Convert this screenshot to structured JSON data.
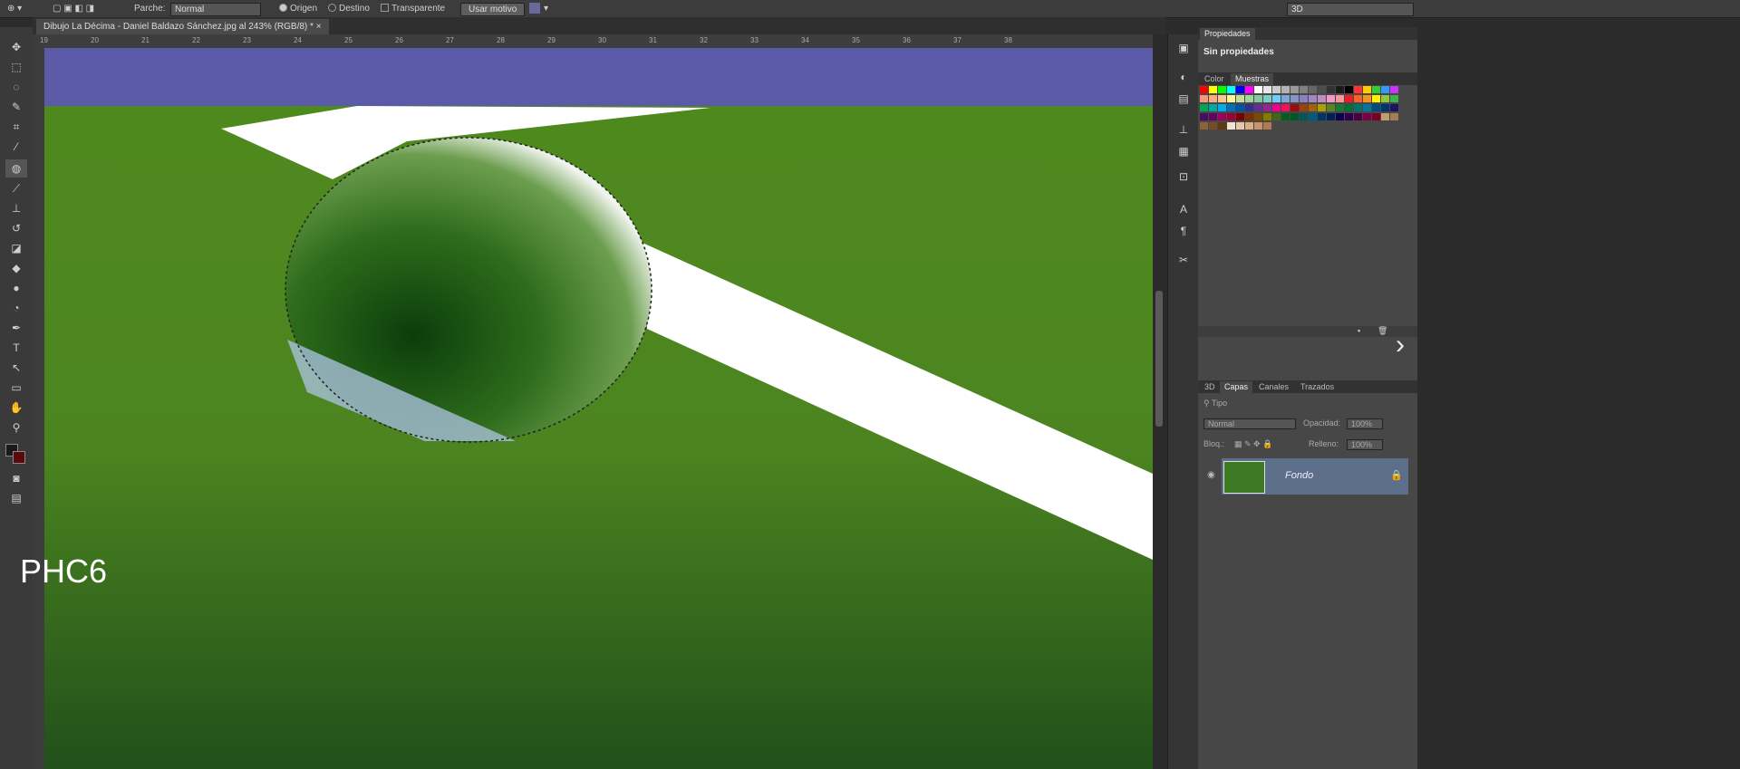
{
  "options_bar": {
    "patch_label": "Parche:",
    "patch_mode": "Normal",
    "radio_source": "Origen",
    "radio_dest": "Destino",
    "transparent_label": "Transparente",
    "use_pattern_button": "Usar motivo",
    "workspace": "3D"
  },
  "document": {
    "tab_title": "Dibujo La Décima - Daniel Baldazo Sánchez.jpg al 243% (RGB/8) *"
  },
  "ruler": {
    "top_ticks": [
      "19",
      "20",
      "21",
      "22",
      "23",
      "24",
      "25",
      "26",
      "27",
      "28",
      "29",
      "30",
      "31",
      "32",
      "33",
      "34",
      "35",
      "36",
      "37",
      "38"
    ]
  },
  "properties_panel": {
    "tab": "Propiedades",
    "content": "Sin propiedades"
  },
  "color_panel": {
    "tabs": [
      "Color",
      "Muestras"
    ],
    "swatch_rows": [
      [
        "#ff0000",
        "#ffff00",
        "#00ff00",
        "#00ffff",
        "#0000ff",
        "#ff00ff",
        "#ffffff",
        "#e6e6e6",
        "#cccccc",
        "#b3b3b3",
        "#999999",
        "#808080",
        "#666666",
        "#4d4d4d",
        "#333333",
        "#1a1a1a",
        "#000000",
        "#ff3333",
        "#ffcc00",
        "#33cc33",
        "#3399ff",
        "#cc33ff"
      ],
      [
        "#f7977a",
        "#f9ad81",
        "#fdc68a",
        "#fff79a",
        "#c4df9b",
        "#a2d39c",
        "#82ca9d",
        "#7bcdc8",
        "#6ecff6",
        "#7ea7d8",
        "#8493ca",
        "#8882be",
        "#a187be",
        "#bc8dbf",
        "#f49ac2",
        "#f6989d",
        "#ed1c24",
        "#f26522",
        "#f7941d",
        "#fff200",
        "#8dc73f",
        "#39b54a"
      ],
      [
        "#00a651",
        "#00a99d",
        "#00aeef",
        "#0072bc",
        "#0054a6",
        "#2e3192",
        "#662d91",
        "#92278f",
        "#ec008c",
        "#ed145b",
        "#9e0b0f",
        "#a0410d",
        "#a36209",
        "#aba000",
        "#598527",
        "#1a7b30",
        "#007236",
        "#00746b",
        "#0076a3",
        "#004b80",
        "#003471",
        "#1b1464"
      ],
      [
        "#440e62",
        "#630460",
        "#9e005d",
        "#9e0039",
        "#790000",
        "#7b2e00",
        "#7d4900",
        "#827b00",
        "#406618",
        "#005e20",
        "#005826",
        "#005952",
        "#005b7f",
        "#003663",
        "#002157",
        "#0d004c",
        "#32004b",
        "#4b0049",
        "#7b0046",
        "#7a0026",
        "#c69c6d",
        "#a67c52"
      ],
      [
        "#8c6239",
        "#754c24",
        "#603913",
        "#f2e4d0",
        "#e6c9a8",
        "#d9ae85",
        "#c99468",
        "#b07a52"
      ]
    ]
  },
  "layers_panel": {
    "tabs": [
      "3D",
      "Capas",
      "Canales",
      "Trazados"
    ],
    "kind_label": "Tipo",
    "blend_mode": "Normal",
    "opacity_label": "Opacidad:",
    "opacity_value": "100%",
    "lock_label": "Bloq.:",
    "fill_label": "Relleno:",
    "fill_value": "100%",
    "layer_name": "Fondo"
  },
  "overlay": {
    "label": "PHC6"
  },
  "colors": {
    "canvas_green": "#4e8a1e",
    "sky_blue": "#5c5ca8",
    "selected_layer": "#5c6e8a"
  }
}
